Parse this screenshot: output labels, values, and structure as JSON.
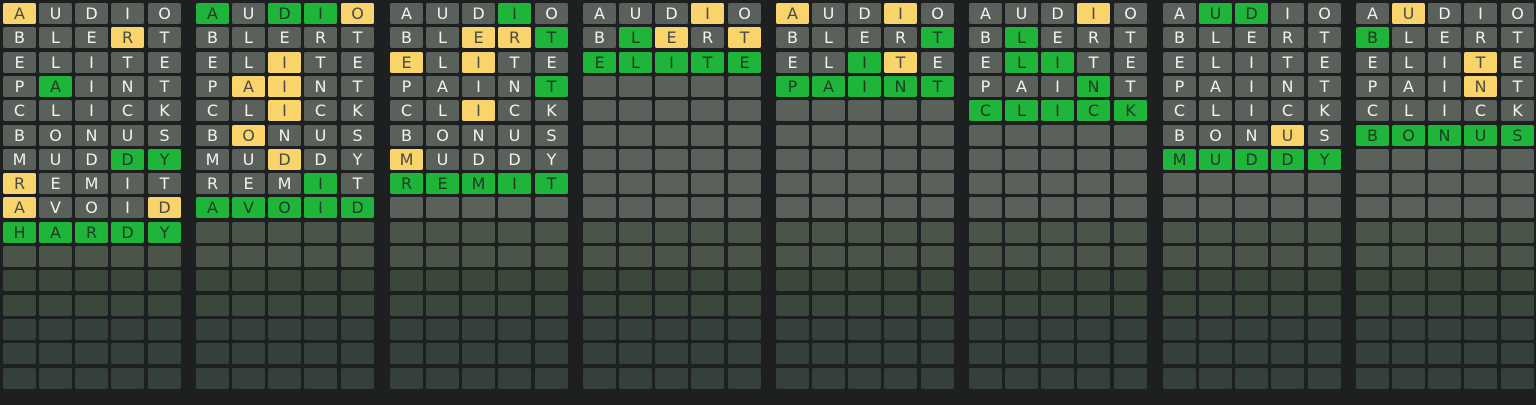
{
  "game": {
    "guesses": [
      "AUDIO",
      "BLERT",
      "ELITE",
      "PAINT",
      "CLICK",
      "BONUS",
      "MUDDY",
      "REMIT",
      "AVOID",
      "HARDY"
    ],
    "total_rows": 16,
    "colors": {
      "background": "#1e1f21",
      "absent": "#5a615b",
      "present": "#f9d46b",
      "correct": "#1fb53a",
      "empty": "#4b5449"
    },
    "boards": [
      {
        "rows": [
          "PAAAA",
          "AAAPA",
          "AAAAA",
          "ACAAA",
          "AAAAA",
          "AAAAA",
          "AAACC",
          "PAAAA",
          "PAAAP",
          "CCCCC"
        ]
      },
      {
        "rows": [
          "CACCP",
          "AAAAA",
          "AAPAA",
          "APPAA",
          "AAPAA",
          "APAAA",
          "AAPAA",
          "AAACA",
          "CCCCC"
        ]
      },
      {
        "rows": [
          "AAACA",
          "AAPPC",
          "PAPAA",
          "AAAAC",
          "AAPAA",
          "AAAAA",
          "PAAAA",
          "CCCCC"
        ]
      },
      {
        "rows": [
          "AAAPA",
          "ACPAP",
          "CCCCC"
        ]
      },
      {
        "rows": [
          "PAAPA",
          "AAAAC",
          "AACPA",
          "CCCCC"
        ]
      },
      {
        "rows": [
          "AAAPA",
          "ACAAA",
          "ACCAA",
          "AAACA",
          "CCCCC"
        ]
      },
      {
        "rows": [
          "ACCAA",
          "AAAAA",
          "AAAAA",
          "AAAAA",
          "AAAAA",
          "AAAPA",
          "CCCCC"
        ]
      },
      {
        "rows": [
          "APAAA",
          "CAAAA",
          "AAAPA",
          "AAAPA",
          "AAAAA",
          "CCCCC"
        ]
      }
    ]
  }
}
